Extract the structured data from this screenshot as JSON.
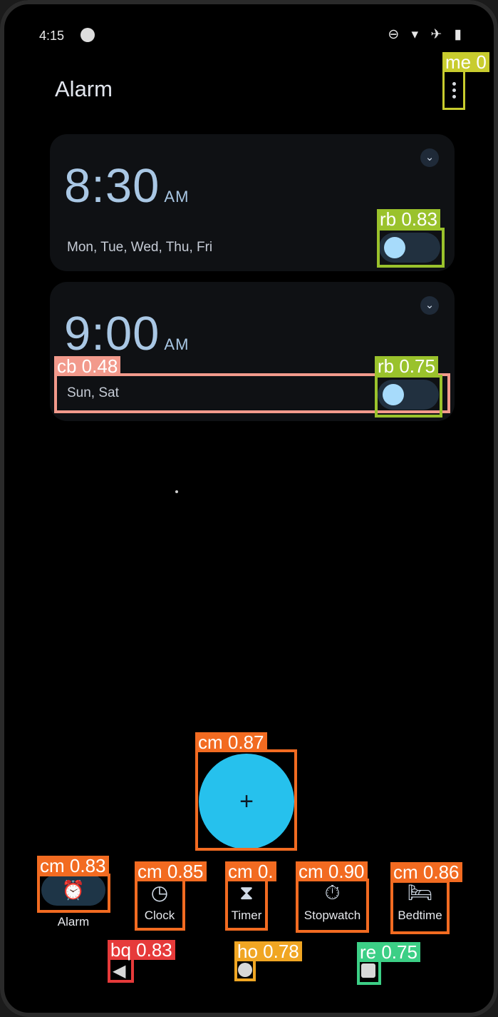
{
  "status": {
    "time": "4:15",
    "icons": "⊖ ▾ ✈ ▮"
  },
  "header": {
    "title": "Alarm"
  },
  "alarms": [
    {
      "time": "8:30",
      "ampm": "AM",
      "days": "Mon, Tue, Wed, Thu, Fri"
    },
    {
      "time": "9:00",
      "ampm": "AM",
      "days": "Sun, Sat"
    }
  ],
  "fab": {
    "label": "+"
  },
  "bottom_nav": [
    {
      "label": "Alarm",
      "icon": "alarm-icon"
    },
    {
      "label": "Clock",
      "icon": "clock-icon"
    },
    {
      "label": "Timer",
      "icon": "hourglass-icon"
    },
    {
      "label": "Stopwatch",
      "icon": "stopwatch-icon"
    },
    {
      "label": "Bedtime",
      "icon": "bed-icon"
    }
  ],
  "detections": {
    "menu": "me 0",
    "toggle1": "rb 0.83",
    "row2": "cb 0.48",
    "toggle2": "rb 0.75",
    "fab": "cm 0.87",
    "nav_alarm": "cm 0.83",
    "nav_clock": "cm 0.85",
    "nav_timer": "cm 0.",
    "nav_stopwatch": "cm 0.90",
    "nav_bedtime": "cm 0.86",
    "back": "bq 0.83",
    "home": "ho 0.78",
    "recents": "re 0.75"
  },
  "colors": {
    "fab": "#26c1ed",
    "toggle_knob": "#a7dbfb",
    "time_text": "#a9c7e4",
    "box_orange": "#f26b21",
    "box_green": "#9ac22c",
    "box_pink": "#f29a8c",
    "box_red": "#e63a3a",
    "box_amber": "#f0a623",
    "box_teal": "#3ccf86",
    "box_yellow": "#c8cc2e"
  }
}
